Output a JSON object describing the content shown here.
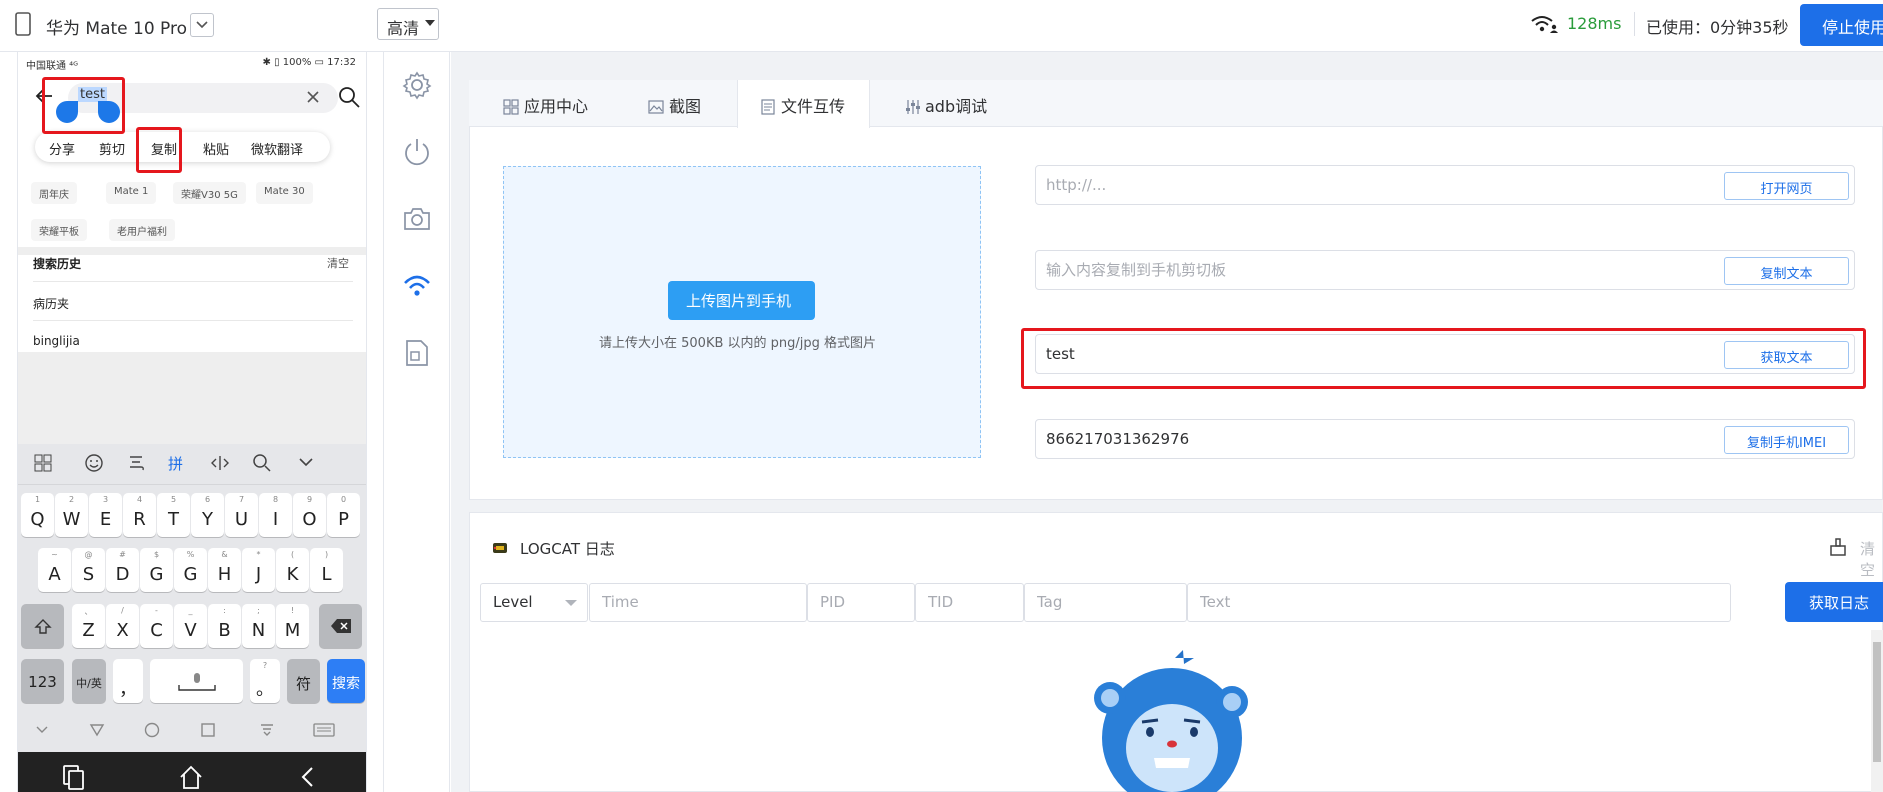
{
  "topbar": {
    "device_name": "华为 Mate 10 Pro",
    "quality": "高清",
    "latency": "128ms",
    "used_time": "已使用：0分钟35秒",
    "stop_button": "停止使用"
  },
  "phone": {
    "status_left": "中国联通 ⁴ᴳ",
    "status_right": "✱ ▯ 100% ▭ 17:32",
    "search_text": "test",
    "context_menu": [
      "分享",
      "剪切",
      "复制",
      "粘贴",
      "微软翻译"
    ],
    "tags": [
      "周年庆",
      "Mate 1",
      "荣耀V30 5G",
      "Mate 30",
      "荣耀平板",
      "老用户福利"
    ],
    "history_title": "搜索历史",
    "history_clear": "清空",
    "history_items": [
      "病历夹",
      "binglijia"
    ],
    "keyboard": {
      "row1": [
        [
          "1",
          "Q"
        ],
        [
          "2",
          "W"
        ],
        [
          "3",
          "E"
        ],
        [
          "4",
          "R"
        ],
        [
          "5",
          "T"
        ],
        [
          "6",
          "Y"
        ],
        [
          "7",
          "U"
        ],
        [
          "8",
          "I"
        ],
        [
          "9",
          "O"
        ],
        [
          "0",
          "P"
        ]
      ],
      "row2": [
        [
          "~",
          "A"
        ],
        [
          "@",
          "S"
        ],
        [
          "#",
          "D"
        ],
        [
          "$",
          "G"
        ],
        [
          "%",
          "G"
        ],
        [
          "&",
          "H"
        ],
        [
          "*",
          "J"
        ],
        [
          "(",
          "K"
        ],
        [
          ")",
          "L"
        ]
      ],
      "row3": [
        [
          "、",
          "Z"
        ],
        [
          "/",
          "X"
        ],
        [
          "-",
          "C"
        ],
        [
          "_",
          "V"
        ],
        [
          ":",
          "B"
        ],
        [
          ";",
          "N"
        ],
        [
          "!",
          "M"
        ]
      ],
      "num_key": "123",
      "lang_key": "中/英",
      "comma_key": "，",
      "period_key": "。",
      "symbol_key": "符",
      "search_key": "搜索",
      "pinyin": "拼"
    }
  },
  "tabs": [
    "应用中心",
    "截图",
    "文件互传",
    "adb调试"
  ],
  "upload": {
    "button": "上传图片到手机",
    "hint": "请上传大小在 500KB 以内的 png/jpg 格式图片"
  },
  "fields": [
    {
      "value": "",
      "placeholder": "http://...",
      "button": "打开网页"
    },
    {
      "value": "",
      "placeholder": "输入内容复制到手机剪切板",
      "button": "复制文本"
    },
    {
      "value": "test",
      "placeholder": "",
      "button": "获取文本"
    },
    {
      "value": "866217031362976",
      "placeholder": "",
      "button": "复制手机IMEI"
    }
  ],
  "logcat": {
    "title": "LOGCAT 日志",
    "clear": "清空",
    "level": "Level",
    "placeholders": [
      "Time",
      "PID",
      "TID",
      "Tag",
      "Text"
    ],
    "get_log": "获取日志"
  },
  "colors": {
    "primary": "#1d6fe8",
    "upload_button": "#2d9ef3",
    "latency_green": "#2a9c3b",
    "highlight_red": "#e5171d"
  }
}
